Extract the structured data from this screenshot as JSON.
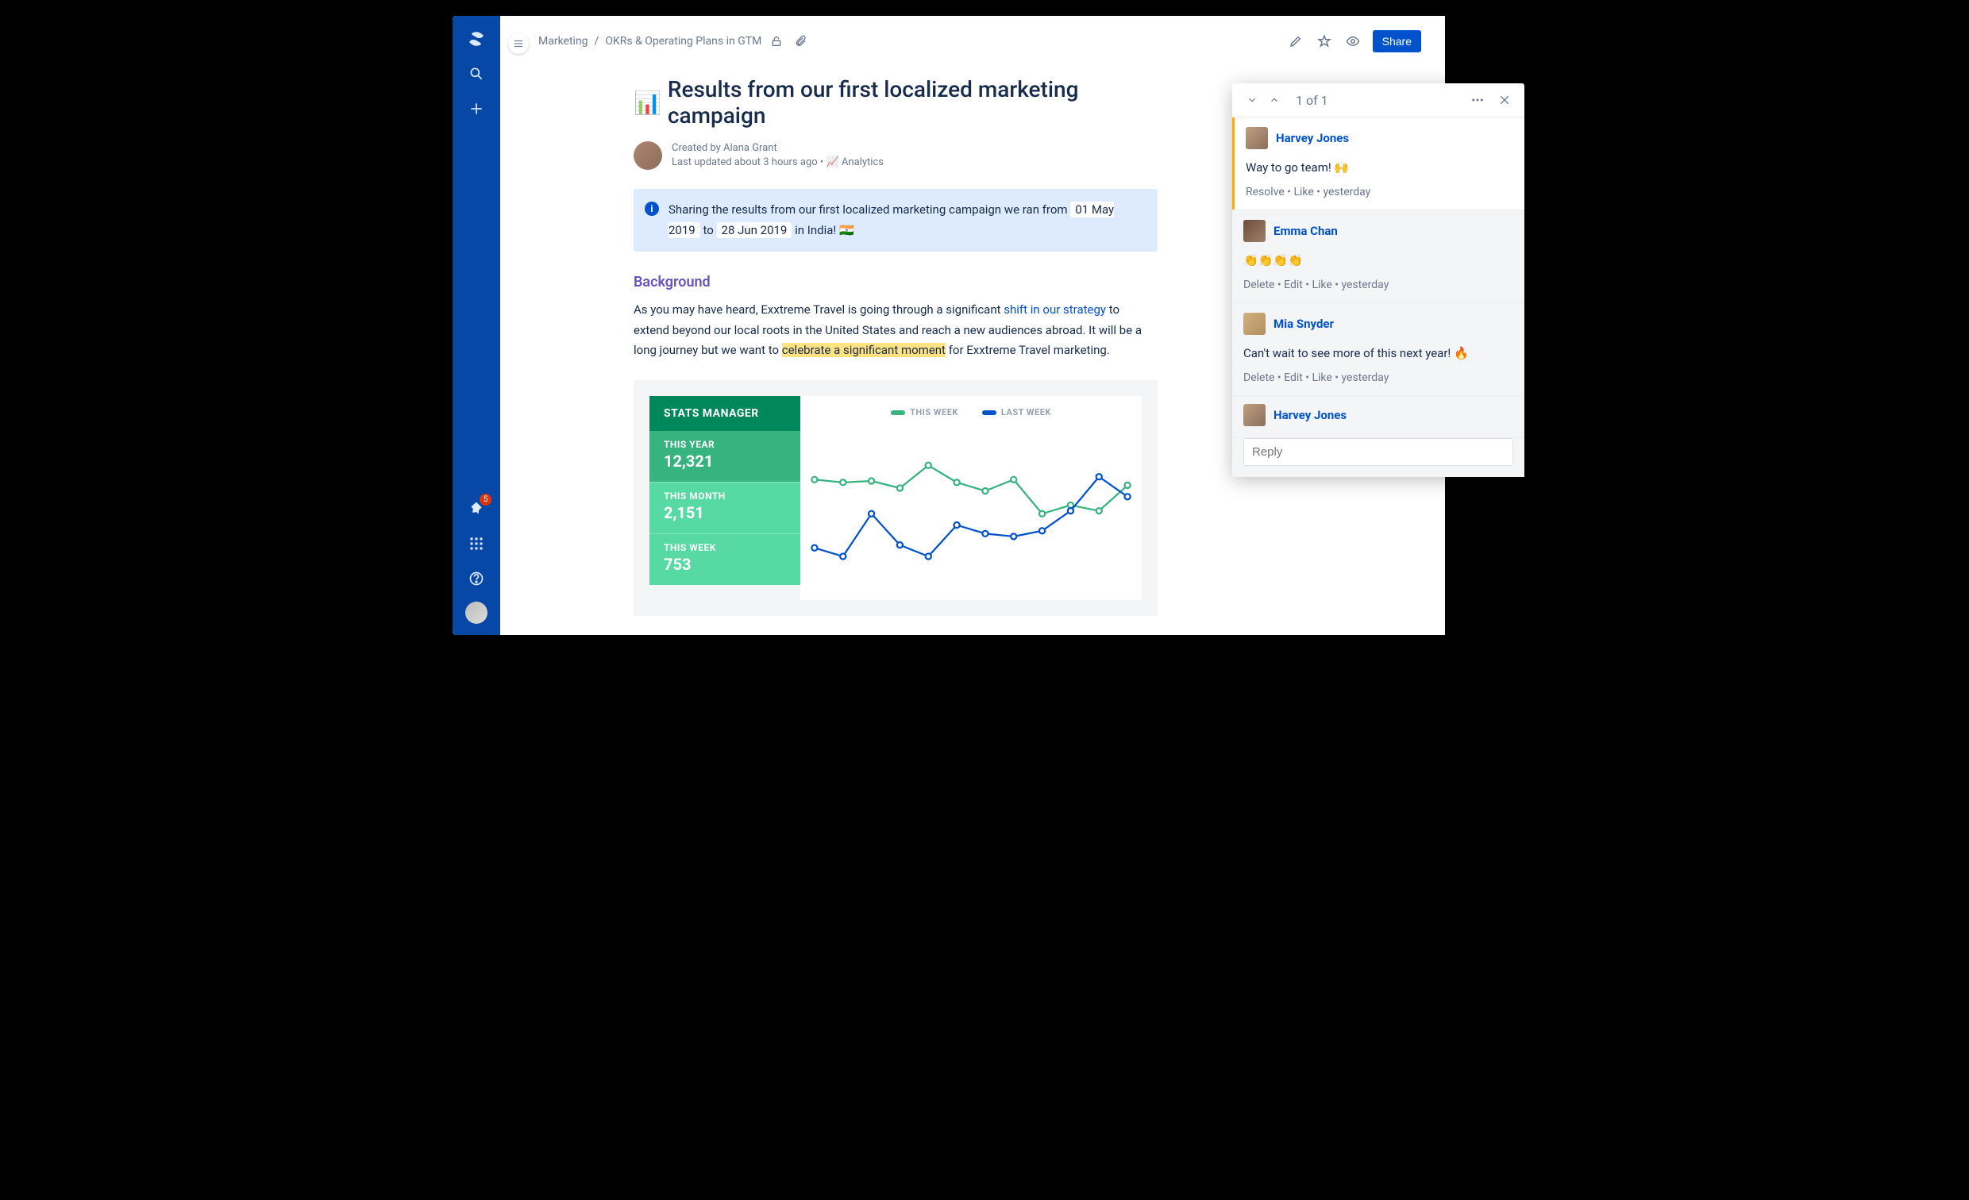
{
  "leftnav": {
    "badge": "5"
  },
  "breadcrumb": {
    "space": "Marketing",
    "page": "OKRs & Operating Plans in GTM"
  },
  "topbar": {
    "share": "Share"
  },
  "page": {
    "title_emoji": "📊",
    "title": "Results from our first localized marketing campaign",
    "author_line": "Created by Alana Grant",
    "updated_line": "Last updated about 3 hours ago",
    "analytics_label": "Analytics"
  },
  "info": {
    "pre": "Sharing the results from our first localized marketing campaign we ran from ",
    "date1": "01 May 2019",
    "mid": " to ",
    "date2": "28 Jun 2019",
    "post": " in India! 🇮🇳"
  },
  "section": {
    "heading": "Background"
  },
  "body": {
    "p1a": "As you may have heard, Exxtreme Travel is going through a significant ",
    "p1link": "shift in our strategy",
    "p1b": " to extend beyond our local roots in the United States and reach a new audiences abroad. It will be a long journey but we want to ",
    "p1hl": "celebrate a significant moment",
    "p1c": " for Exxtreme Travel marketing."
  },
  "stats": {
    "header": "STATS MANAGER",
    "legend_this": "THIS WEEK",
    "legend_last": "LAST WEEK",
    "rows": [
      {
        "label": "THIS YEAR",
        "value": "12,321"
      },
      {
        "label": "THIS MONTH",
        "value": "2,151"
      },
      {
        "label": "THIS WEEK",
        "value": "753"
      }
    ]
  },
  "comments": {
    "counter": "1 of 1",
    "items": [
      {
        "author": "Harvey Jones",
        "body": "Way to go team! 🙌",
        "actions": "Resolve • Like • yesterday",
        "primary": true
      },
      {
        "author": "Emma Chan",
        "body": "👏👏👏👏",
        "actions": "Delete • Edit • Like • yesterday"
      },
      {
        "author": "Mia Snyder",
        "body": "Can't wait to see more of this next year! 🔥",
        "actions": "Delete • Edit • Like • yesterday"
      }
    ],
    "reply_author": "Harvey Jones",
    "reply_placeholder": "Reply"
  },
  "colors": {
    "green": "#36B37E",
    "blue": "#0052CC"
  },
  "chart_data": {
    "type": "line",
    "x": [
      1,
      2,
      3,
      4,
      5,
      6,
      7,
      8,
      9,
      10,
      11,
      12
    ],
    "series": [
      {
        "name": "THIS WEEK",
        "color": "#36B37E",
        "values": [
          68,
          66,
          67,
          62,
          78,
          66,
          60,
          68,
          44,
          50,
          46,
          64
        ]
      },
      {
        "name": "LAST WEEK",
        "color": "#0052CC",
        "values": [
          20,
          14,
          44,
          22,
          14,
          36,
          30,
          28,
          32,
          46,
          70,
          56
        ]
      }
    ],
    "ylim": [
      0,
      100
    ]
  }
}
